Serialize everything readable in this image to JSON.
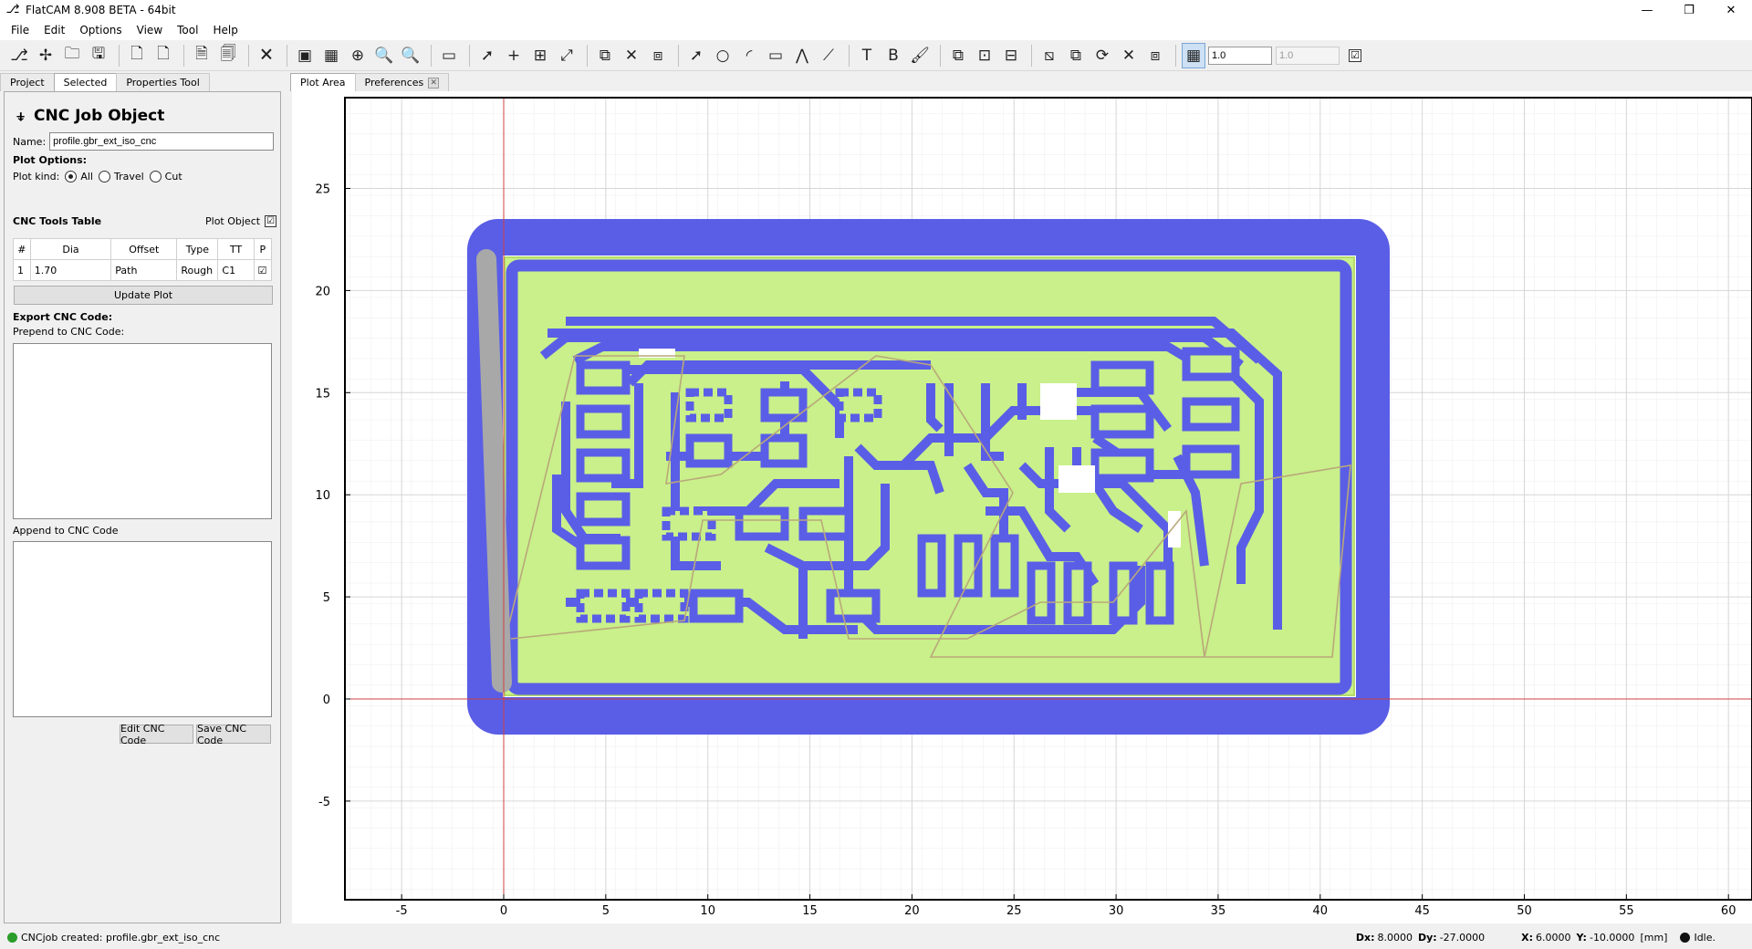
{
  "window": {
    "title": "FlatCAM 8.908 BETA - 64bit",
    "minimize": "—",
    "restore": "❐",
    "close": "✕"
  },
  "menu": [
    "File",
    "Edit",
    "Options",
    "View",
    "Tool",
    "Help"
  ],
  "toolbar": {
    "icons": [
      "new-project-icon",
      "new-geometry-icon",
      "open-icon",
      "save-icon",
      "sep",
      "new-gerber-icon",
      "new-excellon-icon",
      "sep",
      "open-gerber-icon",
      "open-excellon-icon",
      "sep",
      "delete-icon",
      "sep",
      "replot-icon",
      "clear-plot-icon",
      "zoom-fit-icon",
      "zoom-in-icon",
      "zoom-out-icon",
      "sep",
      "shell-icon",
      "sep",
      "select-icon",
      "add-drill-icon",
      "add-array-icon",
      "resize-drill-icon",
      "sep",
      "copy-drill-icon",
      "delete-drill-icon",
      "move-drill-icon",
      "sep",
      "select-shape-icon",
      "circle-icon",
      "arc-icon",
      "rectangle-icon",
      "polygon-icon",
      "path-icon",
      "sep",
      "text-icon",
      "buffer-icon",
      "paint-icon",
      "sep",
      "union-icon",
      "intersection-icon",
      "subtraction-icon",
      "sep",
      "cut-path-icon",
      "copy-shape-icon",
      "rotate-icon",
      "delete-shape-icon",
      "move-shape-icon",
      "sep",
      "grid-snap-icon"
    ],
    "glyphs": {
      "new-project-icon": "⎇",
      "new-geometry-icon": "✢",
      "open-icon": "🗀",
      "save-icon": "🖫",
      "new-gerber-icon": "🗋",
      "new-excellon-icon": "🗋",
      "open-gerber-icon": "🗎",
      "open-excellon-icon": "🗐",
      "delete-icon": "🗙",
      "replot-icon": "▣",
      "clear-plot-icon": "▦",
      "zoom-fit-icon": "⊕",
      "zoom-in-icon": "🔍",
      "zoom-out-icon": "🔍",
      "shell-icon": "▭",
      "select-icon": "➚",
      "add-drill-icon": "+",
      "add-array-icon": "⊞",
      "resize-drill-icon": "⤢",
      "copy-drill-icon": "⧉",
      "delete-drill-icon": "✕",
      "move-drill-icon": "⧈",
      "select-shape-icon": "➚",
      "circle-icon": "○",
      "arc-icon": "◜",
      "rectangle-icon": "▭",
      "polygon-icon": "⋀",
      "path-icon": "⟋",
      "text-icon": "T",
      "buffer-icon": "B",
      "paint-icon": "🖌",
      "union-icon": "⧉",
      "intersection-icon": "⊡",
      "subtraction-icon": "⊟",
      "cut-path-icon": "⧅",
      "copy-shape-icon": "⧉",
      "rotate-icon": "⟳",
      "delete-shape-icon": "✕",
      "move-shape-icon": "⧈",
      "grid-snap-icon": "▦"
    },
    "grid_x": "1.0",
    "grid_y": "1.0",
    "check": "☑"
  },
  "left_tabs": [
    "Project",
    "Selected",
    "Properties Tool"
  ],
  "panel": {
    "title": "CNC Job Object",
    "name_label": "Name:",
    "name_value": "profile.gbr_ext_iso_cnc",
    "plot_options": "Plot Options:",
    "plot_kind_label": "Plot kind:",
    "plot_kinds": [
      "All",
      "Travel",
      "Cut"
    ],
    "tools_table_label": "CNC Tools Table",
    "plot_object_label": "Plot Object",
    "table_headers": [
      "#",
      "Dia",
      "Offset",
      "Type",
      "TT",
      "P"
    ],
    "table_rows": [
      [
        "1",
        "1.70",
        "Path",
        "Rough",
        "C1",
        "☑"
      ]
    ],
    "update_plot": "Update Plot",
    "export_label": "Export CNC Code:",
    "prepend_label": "Prepend to CNC Code:",
    "append_label": "Append to CNC Code",
    "edit_btn": "Edit CNC Code",
    "save_btn": "Save CNC Code"
  },
  "right_tabs": {
    "plot": "Plot Area",
    "prefs": "Preferences",
    "close": "✕"
  },
  "plot": {
    "x_ticks": [
      "-5",
      "0",
      "5",
      "10",
      "15",
      "20",
      "25",
      "30",
      "35",
      "40",
      "45",
      "50",
      "55",
      "60"
    ],
    "y_ticks": [
      "25",
      "20",
      "15",
      "10",
      "5",
      "0",
      "-5"
    ],
    "colors": {
      "copper": "#5a5ee6",
      "board": "#c9f08a",
      "travel": "#b9a87a",
      "outline": "#a8a8a8",
      "axis": "#d04040"
    }
  },
  "status": {
    "message": "CNCjob created: profile.gbr_ext_iso_cnc",
    "dx_label": "Dx:",
    "dx": "8.0000",
    "dy_label": "Dy:",
    "dy": "-27.0000",
    "x_label": "X:",
    "x": "6.0000",
    "y_label": "Y:",
    "y": "-10.0000",
    "units": "[mm]",
    "state": "Idle."
  }
}
